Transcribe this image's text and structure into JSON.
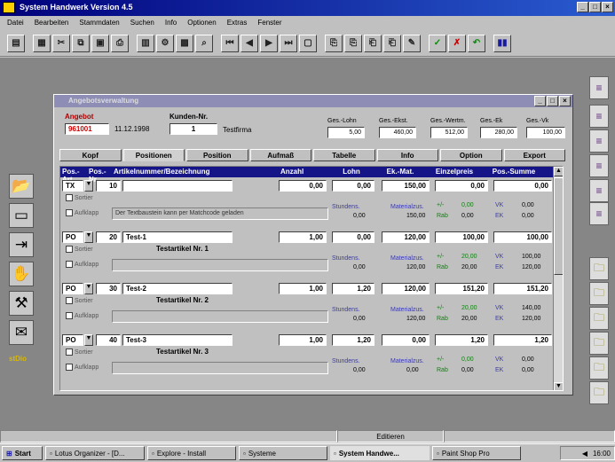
{
  "app": {
    "title": "System Handwerk Version 4.5"
  },
  "menu": [
    "Datei",
    "Bearbeiten",
    "Stammdaten",
    "Suchen",
    "Info",
    "Optionen",
    "Extras",
    "Fenster"
  ],
  "toolbar_icons": [
    "open",
    "save",
    "cut",
    "copy",
    "paste",
    "print",
    "table",
    "settings",
    "find",
    "first",
    "prev",
    "next",
    "last",
    "preview",
    "doc1",
    "doc2",
    "doc3",
    "doc4",
    "check",
    "delete",
    "undo",
    "chart"
  ],
  "window": {
    "title": "Angebotsverwaltung",
    "angebot_label": "Angebot",
    "angebot_nr": "961001",
    "date": "11.12.1998",
    "kunden_label": "Kunden-Nr.",
    "kunden_nr": "1",
    "kunden_name": "Testfirma",
    "summaries": [
      {
        "label": "Ges.-Lohn",
        "value": "5,00"
      },
      {
        "label": "Ges.-Ekst.",
        "value": "460,00"
      },
      {
        "label": "Ges.-Wertm.",
        "value": "512,00"
      },
      {
        "label": "Ges.-Ek",
        "value": "280,00"
      },
      {
        "label": "Ges.-Vk",
        "value": "100,00"
      }
    ]
  },
  "tabs": [
    "Kopf",
    "Positionen",
    "Position",
    "Aufmaß",
    "Tabelle",
    "Info",
    "Option",
    "Export"
  ],
  "columns": [
    "Pos.-Art",
    "Pos.-Nr.",
    "Artikelnummer/Bezeichnung",
    "Anzahl",
    "Lohn",
    "Ek.-Mat.",
    "Einzelpreis",
    "Pos.-Summe"
  ],
  "rows": [
    {
      "art": "TX",
      "nr": "10",
      "artnr": "",
      "name": "",
      "desc": "Der Textbaustein kann per Matchcode geladen",
      "anzahl": "0,00",
      "lohn": "0,00",
      "ek": "150,00",
      "ep": "0,00",
      "sum": "0,00",
      "small_left": "0,00",
      "small_mid": "150,00",
      "ep_small": "0,00",
      "rab": "0,00",
      "vk": "0,00",
      "ek2": "0,00"
    },
    {
      "art": "PO",
      "nr": "20",
      "artnr": "Test-1",
      "name": "Testartikel Nr. 1",
      "desc": "",
      "anzahl": "1,00",
      "lohn": "0,00",
      "ek": "120,00",
      "ep": "100,00",
      "sum": "100,00",
      "small_left": "0,00",
      "small_mid": "120,00",
      "ep_small": "20,00",
      "rab": "20,00",
      "vk": "100,00",
      "ek2": "120,00"
    },
    {
      "art": "PO",
      "nr": "30",
      "artnr": "Test-2",
      "name": "Testartikel Nr. 2",
      "desc": "",
      "anzahl": "1,00",
      "lohn": "1,20",
      "ek": "120,00",
      "ep": "151,20",
      "sum": "151,20",
      "small_left": "0,00",
      "small_mid": "120,00",
      "ep_small": "20,00",
      "rab": "20,00",
      "vk": "140,00",
      "ek2": "120,00"
    },
    {
      "art": "PO",
      "nr": "40",
      "artnr": "Test-3",
      "name": "Testartikel Nr. 3",
      "desc": "",
      "anzahl": "1,00",
      "lohn": "1,20",
      "ek": "0,00",
      "ep": "1,20",
      "sum": "1,20",
      "small_left": "0,00",
      "small_mid": "0,00",
      "ep_small": "0,00",
      "rab": "0,00",
      "vk": "0,00",
      "ek2": "0,00"
    }
  ],
  "row_labels": {
    "sortieren": "Sortier",
    "aufklappen": "Aufklapp",
    "stundensatz": "Stundens.",
    "materialzuschlag": "Materialzus.",
    "rab": "Rab",
    "vk": "VK",
    "ek": "EK",
    "plusminus": "+/-"
  },
  "status": {
    "center": "Editieren"
  },
  "taskbar": {
    "start": "Start",
    "items": [
      "Lotus Organizer - [D...",
      "Explore - Install",
      "Systeme",
      "System Handwe...",
      "Paint Shop Pro"
    ],
    "active_index": 3,
    "clock": "16:00"
  },
  "left_icons": [
    "folder-icon",
    "window-icon",
    "exit-icon",
    "hand-icon",
    "tools-icon",
    "mail-icon"
  ],
  "left_footer": "stDio",
  "right_icons": [
    "doc-icon",
    "doc-icon",
    "doc-icon",
    "doc-icon",
    "doc-icon",
    "folder-icon",
    "folder-icon",
    "folder-icon",
    "folder-icon",
    "folder-icon",
    "folder-icon"
  ]
}
